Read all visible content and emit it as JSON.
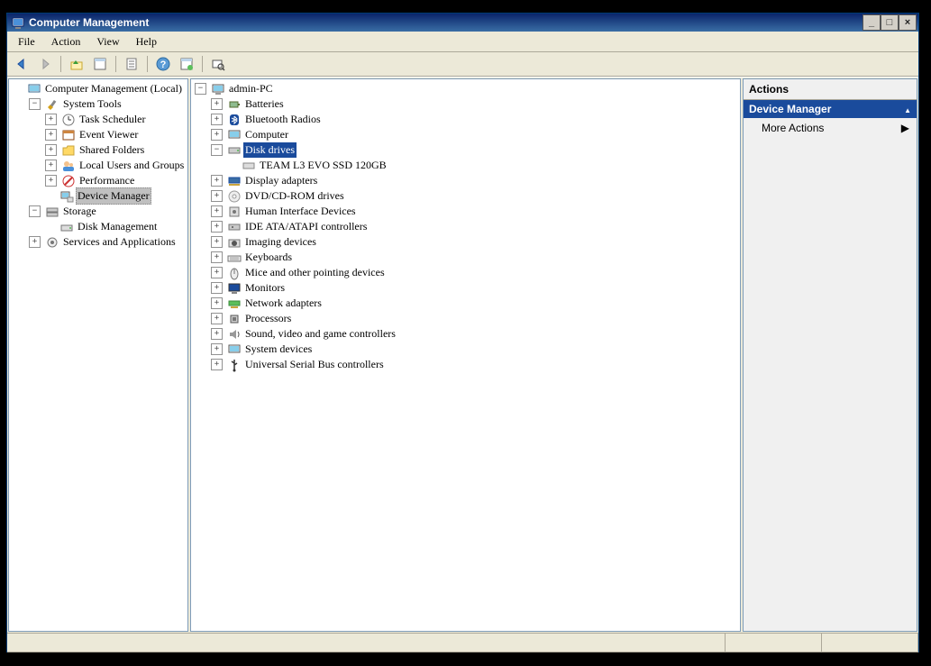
{
  "title": "Computer Management",
  "menu": [
    "File",
    "Action",
    "View",
    "Help"
  ],
  "nav_tree": {
    "root": "Computer Management (Local)",
    "sys_tools": "System Tools",
    "task_scheduler": "Task Scheduler",
    "event_viewer": "Event Viewer",
    "shared_folders": "Shared Folders",
    "local_users": "Local Users and Groups",
    "performance": "Performance",
    "device_manager": "Device Manager",
    "storage": "Storage",
    "disk_mgmt": "Disk Management",
    "services_apps": "Services and Applications"
  },
  "device_tree": {
    "root": "admin-PC",
    "batteries": "Batteries",
    "bluetooth": "Bluetooth Radios",
    "computer": "Computer",
    "disk_drives": "Disk drives",
    "disk_child": "TEAM L3 EVO SSD 120GB",
    "display": "Display adapters",
    "dvd": "DVD/CD-ROM drives",
    "hid": "Human Interface Devices",
    "ide": "IDE ATA/ATAPI controllers",
    "imaging": "Imaging devices",
    "keyboards": "Keyboards",
    "mice": "Mice and other pointing devices",
    "monitors": "Monitors",
    "network": "Network adapters",
    "processors": "Processors",
    "sound": "Sound, video and game controllers",
    "system": "System devices",
    "usb": "Universal Serial Bus controllers"
  },
  "actions": {
    "header": "Actions",
    "section": "Device Manager",
    "more": "More Actions"
  }
}
